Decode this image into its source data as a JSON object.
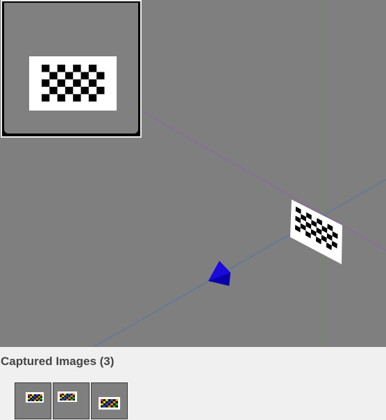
{
  "viewport": {
    "background": "#7f7f7f",
    "axis_colors": {
      "vertical": "#5a9a3c",
      "diagonal": "#9060b0",
      "ray": "#4a78a8"
    },
    "camera_color": "#1a0adc",
    "board_rows": 5,
    "board_cols": 8
  },
  "captured": {
    "title": "Captured Images (3)",
    "thumbnail_count": 3
  }
}
